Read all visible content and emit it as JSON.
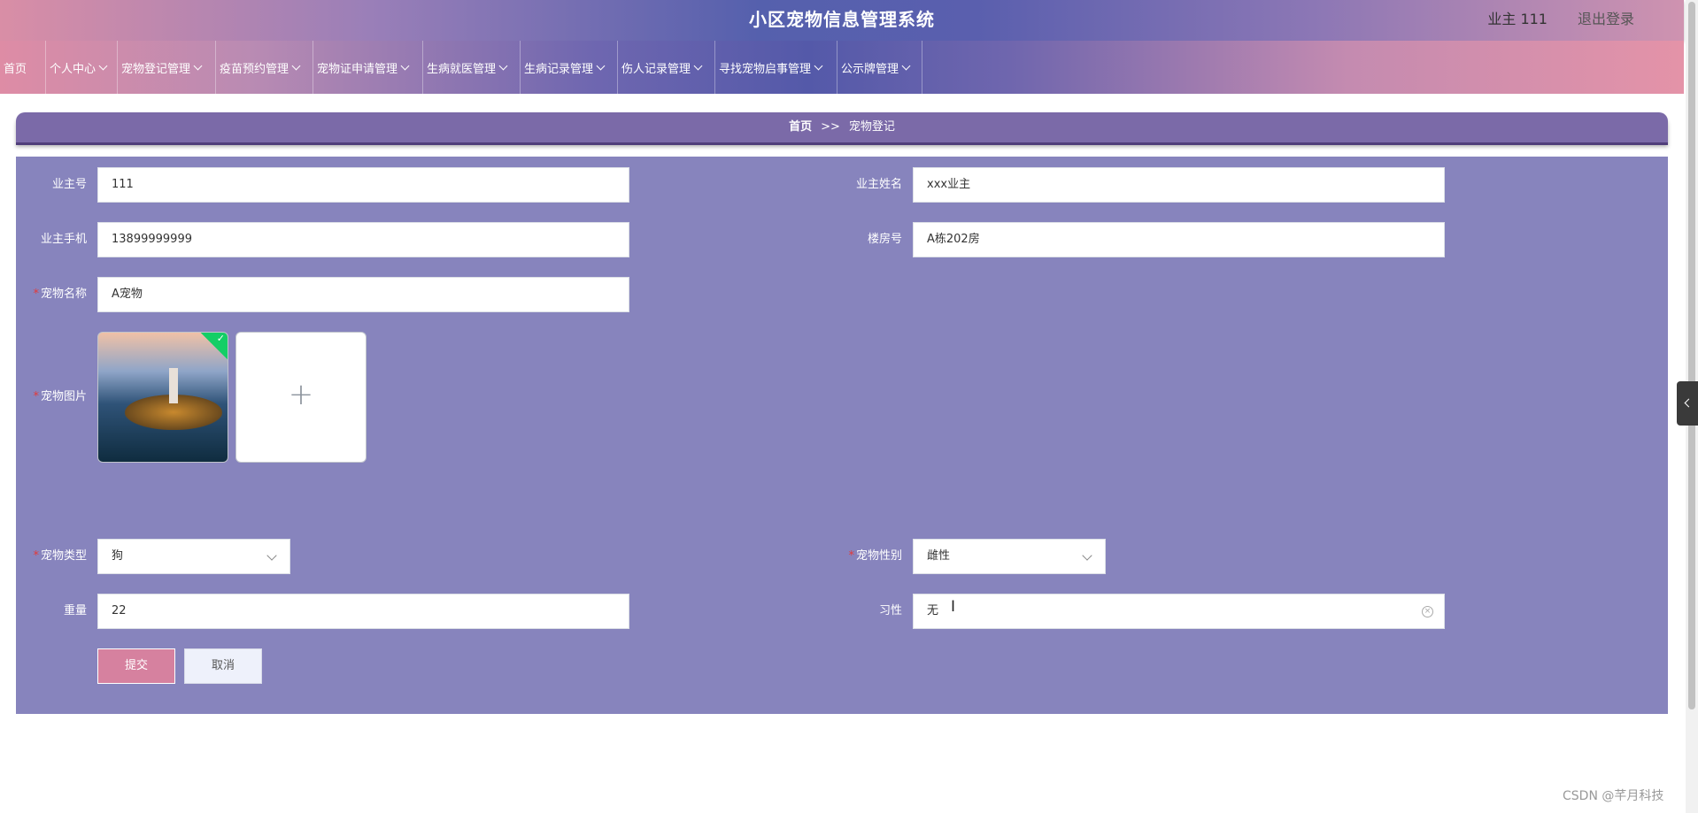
{
  "header": {
    "title": "小区宠物信息管理系统",
    "user": "业主 111",
    "logout": "退出登录"
  },
  "nav": [
    {
      "label": "首页",
      "dropdown": false
    },
    {
      "label": "个人中心",
      "dropdown": true
    },
    {
      "label": "宠物登记管理",
      "dropdown": true
    },
    {
      "label": "疫苗预约管理",
      "dropdown": true
    },
    {
      "label": "宠物证申请管理",
      "dropdown": true
    },
    {
      "label": "生病就医管理",
      "dropdown": true
    },
    {
      "label": "生病记录管理",
      "dropdown": true
    },
    {
      "label": "伤人记录管理",
      "dropdown": true
    },
    {
      "label": "寻找宠物启事管理",
      "dropdown": true
    },
    {
      "label": "公示牌管理",
      "dropdown": true
    }
  ],
  "breadcrumb": {
    "home": "首页",
    "separator": ">>",
    "current": "宠物登记"
  },
  "form": {
    "owner_no": {
      "label": "业主号",
      "value": "111"
    },
    "owner_name": {
      "label": "业主姓名",
      "value": "xxx业主"
    },
    "owner_phone": {
      "label": "业主手机",
      "value": "13899999999"
    },
    "building_no": {
      "label": "楼房号",
      "value": "A栋202房"
    },
    "pet_name": {
      "label": "宠物名称",
      "value": "A宠物"
    },
    "pet_image": {
      "label": "宠物图片"
    },
    "pet_type": {
      "label": "宠物类型",
      "value": "狗"
    },
    "pet_gender": {
      "label": "宠物性别",
      "value": "雌性"
    },
    "weight": {
      "label": "重量",
      "value": "22"
    },
    "habit": {
      "label": "习性",
      "value": "无"
    },
    "required_mark": "*",
    "upload_plus": "+",
    "submit": "提交",
    "cancel": "取消"
  },
  "watermark": "CSDN @芊月科技",
  "colors": {
    "panel": "#8784bd",
    "breadcrumb": "#7b6aa8",
    "submit": "#d6819f",
    "success": "#13ce66"
  }
}
